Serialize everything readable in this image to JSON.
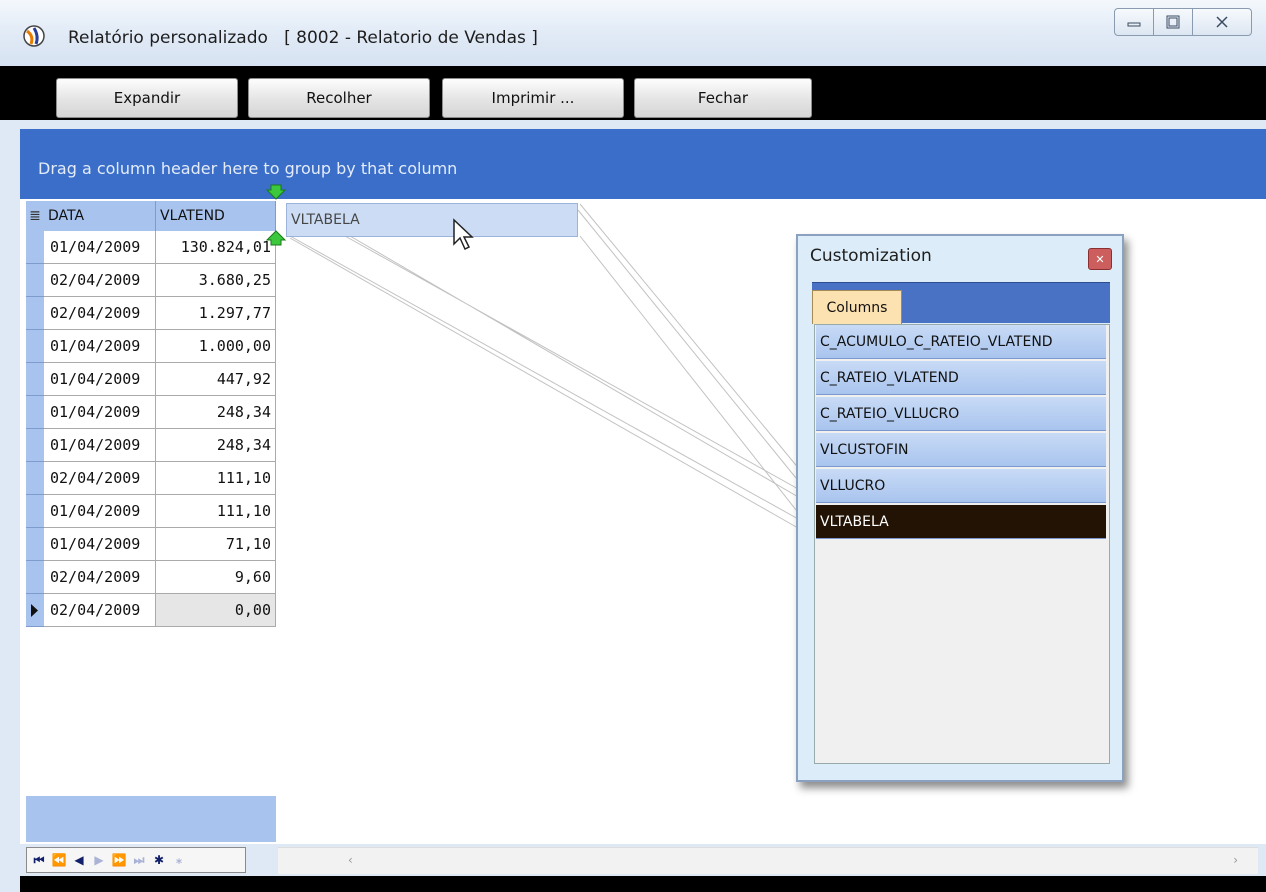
{
  "window": {
    "title": "Relatório personalizado   [ 8002 - Relatorio de Vendas ]",
    "controls": {
      "minimize": "minimize-icon",
      "maximize": "maximize-icon",
      "close": "close-icon"
    }
  },
  "toolbar": {
    "expand": "Expandir",
    "collapse": "Recolher",
    "print": "Imprimir ...",
    "close": "Fechar"
  },
  "group_panel": {
    "hint": "Drag a column header here to group by that column"
  },
  "grid": {
    "columns": [
      "DATA",
      "VLATEND"
    ],
    "rows": [
      {
        "data": "01/04/2009",
        "vlatend": "130.824,01"
      },
      {
        "data": "02/04/2009",
        "vlatend": "3.680,25"
      },
      {
        "data": "02/04/2009",
        "vlatend": "1.297,77"
      },
      {
        "data": "01/04/2009",
        "vlatend": "1.000,00"
      },
      {
        "data": "01/04/2009",
        "vlatend": "447,92"
      },
      {
        "data": "01/04/2009",
        "vlatend": "248,34"
      },
      {
        "data": "01/04/2009",
        "vlatend": "248,34"
      },
      {
        "data": "02/04/2009",
        "vlatend": "111,10"
      },
      {
        "data": "01/04/2009",
        "vlatend": "111,10"
      },
      {
        "data": "01/04/2009",
        "vlatend": "71,10"
      },
      {
        "data": "02/04/2009",
        "vlatend": "9,60"
      },
      {
        "data": "02/04/2009",
        "vlatend": "0,00"
      }
    ],
    "drag_column": "VLTABELA"
  },
  "customization": {
    "title": "Customization",
    "tab": "Columns",
    "items": [
      "C_ACUMULO_C_RATEIO_VLATEND",
      "C_RATEIO_VLATEND",
      "C_RATEIO_VLLUCRO",
      "VLCUSTOFIN",
      "VLLUCRO",
      "VLTABELA"
    ],
    "selected": "VLTABELA"
  },
  "colors": {
    "accent": "#3a6ec8",
    "header": "#a8c4ee",
    "selected": "#231305",
    "tab": "#fde2b1"
  }
}
